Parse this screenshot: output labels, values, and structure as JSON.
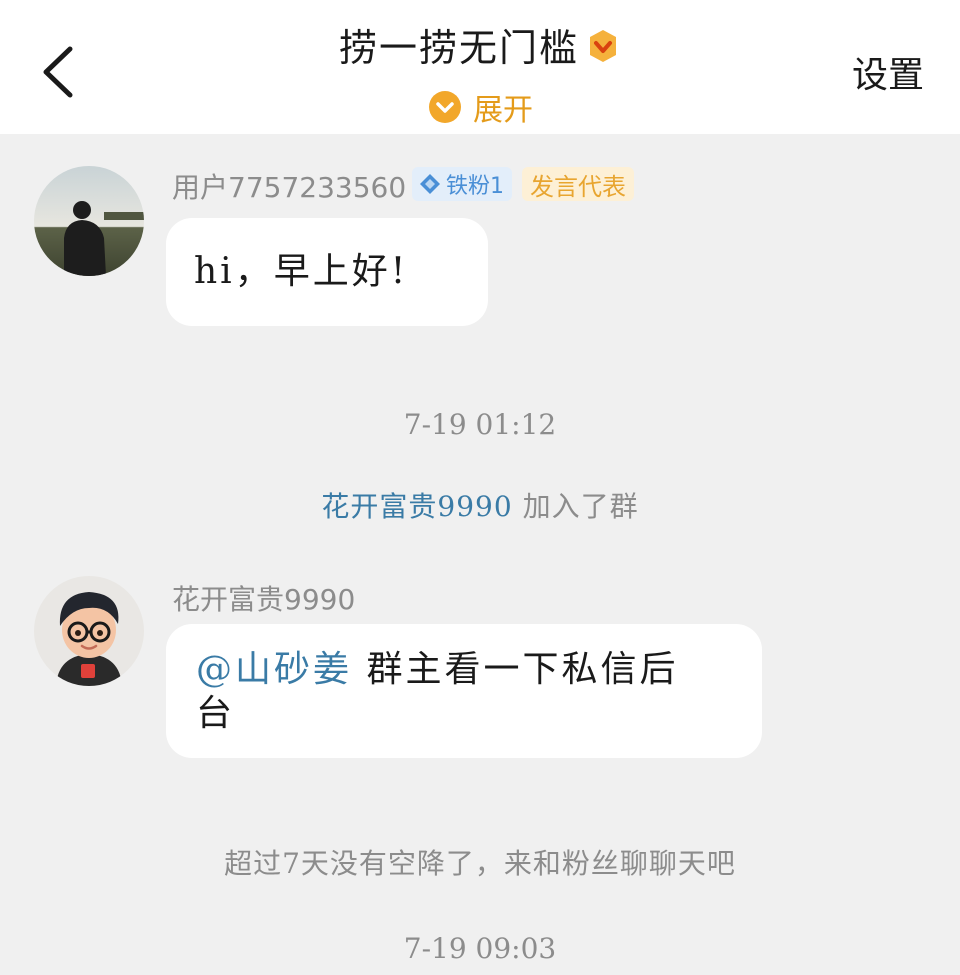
{
  "header": {
    "title": "捞一捞无门槛",
    "expand_label": "展开",
    "settings_label": "设置"
  },
  "messages": [
    {
      "username": "用户7757233560",
      "fan_badge": "铁粉1",
      "role_badge": "发言代表",
      "text": "hi，早上好!"
    },
    {
      "username": "花开富贵9990",
      "mention": "@山砂姜",
      "text_line1": "群主看一下私信后",
      "text_line2": "台"
    }
  ],
  "timestamps": [
    "7-19 01:12",
    "7-19 09:03"
  ],
  "system": {
    "join_name": "花开富贵9990",
    "join_suffix": "加入了群",
    "airdrop_notice": "超过7天没有空降了，来和粉丝聊聊天吧"
  },
  "colors": {
    "accent_orange": "#e49b1a",
    "mention_blue": "#3a7ba6",
    "fan_badge_blue": "#4a8fd6"
  }
}
